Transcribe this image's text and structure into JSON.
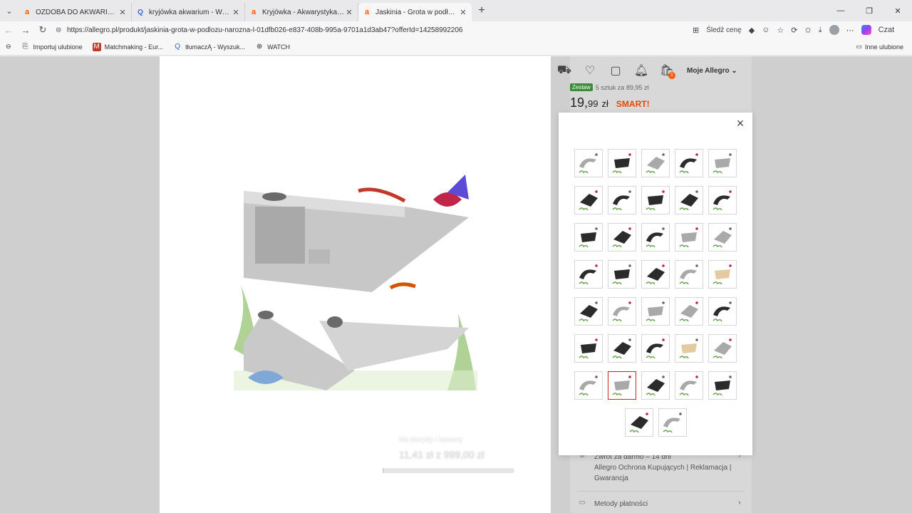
{
  "browser": {
    "tabs": [
      {
        "title": "OZDOBA DO AKWARIUM DLA DZ",
        "icon": "allegro-icon",
        "active": false
      },
      {
        "title": "kryjówka akwarium - Wyszukaj",
        "icon": "search-icon",
        "active": false
      },
      {
        "title": "Kryjówka - Akwarystyka - sprzęt i a",
        "icon": "allegro-icon",
        "active": false
      },
      {
        "title": "Jaskinia - Grota w podłożu - Naroż",
        "icon": "allegro-icon",
        "active": true
      }
    ],
    "url": "https://allegro.pl/produkt/jaskinia-grota-w-podlozu-narozna-l-01dfb026-e837-408b-995a-9701a1d3ab47?offerId=14258992206",
    "track_price_label": "Śledź cenę",
    "favorites": [
      {
        "label": "Importuj ulubione",
        "icon": "import-icon"
      },
      {
        "label": "Matchmaking - Eur...",
        "icon": "matchmaking-icon"
      },
      {
        "label": "tłumaczĄ - Wyszuk...",
        "icon": "search-icon"
      },
      {
        "label": "WATCH",
        "icon": "globe-icon"
      }
    ],
    "other_favorites_label": "Inne ulubione"
  },
  "allegro": {
    "header_account_label": "Moje Allegro",
    "cart_count": "1",
    "set_badge": "Zestaw",
    "set_text": "5 sztuk za 89,95 zł",
    "price_main": "19,",
    "price_cents": "99",
    "price_currency": "zł",
    "smart_label": "SMART!"
  },
  "hero": {
    "caption": "Na sterydy i kamerę",
    "price_text": "11,41 zł z 999,00 zł",
    "progress": 0.01
  },
  "modal": {
    "close_label": "×",
    "thumbnails_per_row": [
      5,
      5,
      5,
      5,
      5,
      5,
      5,
      2
    ],
    "selected_index": 31,
    "thumb_variants": [
      "grey",
      "dark",
      "grey",
      "dark",
      "grey",
      "dark",
      "dark",
      "dark",
      "dark",
      "dark",
      "dark",
      "dark",
      "dark",
      "grey",
      "grey",
      "dark",
      "dark",
      "dark",
      "grey",
      "sand",
      "dark",
      "grey",
      "grey",
      "grey",
      "dark",
      "dark",
      "dark",
      "dark",
      "sand",
      "grey",
      "grey",
      "grey",
      "dark",
      "grey",
      "dark",
      "dark",
      "grey"
    ]
  },
  "info": {
    "returns": "Zwrot za darmo – 14 dni",
    "protection": "Allegro Ochrona Kupujących | Reklamacja | Gwarancja",
    "payment_methods": "Metody płatności"
  }
}
